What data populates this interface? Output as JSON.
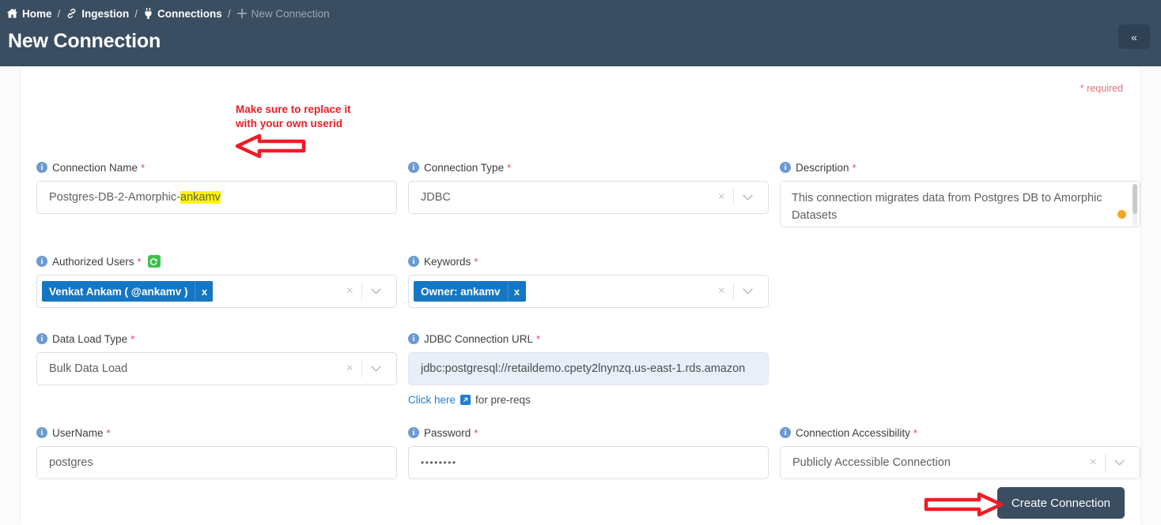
{
  "header": {
    "breadcrumb": [
      {
        "label": "Home",
        "icon": "home-icon",
        "muted": false
      },
      {
        "label": "Ingestion",
        "icon": "link-icon",
        "muted": false
      },
      {
        "label": "Connections",
        "icon": "plug-icon",
        "muted": false
      },
      {
        "label": "New Connection",
        "icon": "plus-icon",
        "muted": true
      }
    ],
    "separator": "/",
    "title": "New Connection",
    "collapse_icon": "«",
    "collapse_name": "collapse-sidebar-button",
    "bg_color": "#3a4d61"
  },
  "form": {
    "required_note": "* required",
    "required_star": "*",
    "fields": {
      "connection_name": {
        "label": "Connection Name",
        "value_prefix": "Postgres-DB-2-Amorphic-",
        "value_highlight": "ankamv",
        "value_full": "Postgres-DB-2-Amorphic-ankamv"
      },
      "connection_type": {
        "label": "Connection Type",
        "value": "JDBC",
        "clear_icon": "×",
        "caret_icon": "chevron-down-icon"
      },
      "description": {
        "label": "Description",
        "value": "This connection migrates data from Postgres DB to Amorphic Datasets"
      },
      "authorized_users": {
        "label": "Authorized Users",
        "refresh_icon": "refresh-icon",
        "tags": [
          "Venkat Ankam ( @ankamv )"
        ],
        "tag_remove": "x",
        "clear_icon": "×"
      },
      "keywords": {
        "label": "Keywords",
        "tags": [
          "Owner: ankamv"
        ],
        "tag_remove": "x",
        "clear_icon": "×"
      },
      "data_load_type": {
        "label": "Data Load Type",
        "value": "Bulk Data Load",
        "clear_icon": "×"
      },
      "jdbc_url": {
        "label": "JDBC Connection URL",
        "value": "jdbc:postgresql://retaildemo.cpety2lnynzq.us-east-1.rds.amazon",
        "hint_link": "Click here",
        "hint_suffix": "for pre-reqs",
        "hint_icon": "external-link-icon"
      },
      "username": {
        "label": "UserName",
        "value": "postgres"
      },
      "password": {
        "label": "Password",
        "value": "••••••••"
      },
      "connection_accessibility": {
        "label": "Connection Accessibility",
        "value": "Publicly Accessible Connection",
        "clear_icon": "×"
      }
    },
    "submit_label": "Create Connection"
  },
  "annotations": {
    "note_line1": "Make sure to replace it",
    "note_line2": "with your own userid",
    "color": "#ee1c25"
  }
}
